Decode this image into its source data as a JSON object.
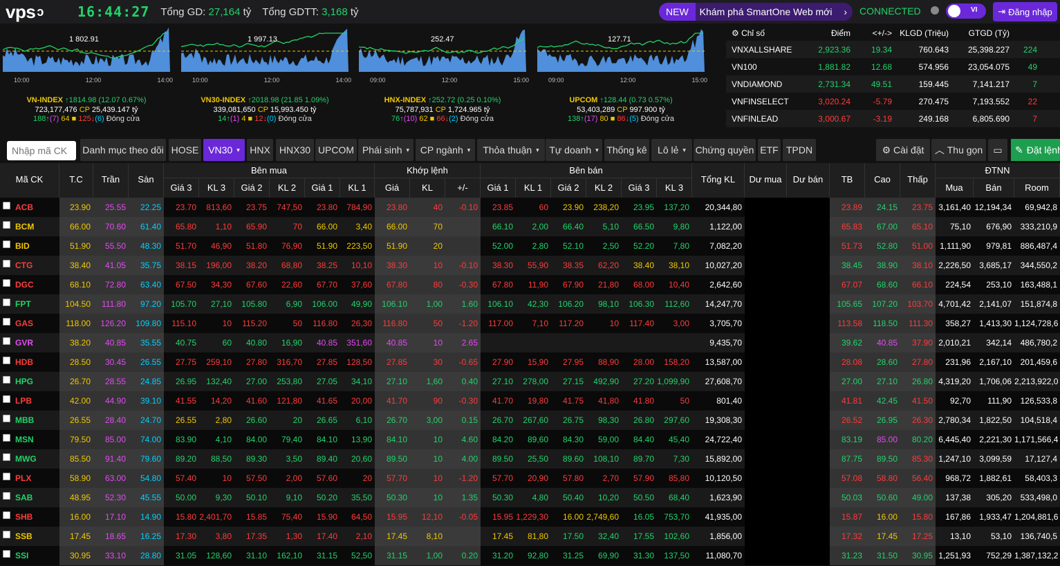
{
  "header": {
    "logo": "vps",
    "clock": "16:44:27",
    "tong_gd_label": "Tổng GD:",
    "tong_gd_value": "27,164",
    "tong_gd_unit": "tỷ",
    "tong_gdtt_label": "Tổng GDTT:",
    "tong_gdtt_value": "3,168",
    "tong_gdtt_unit": "tỷ",
    "new_badge": "NEW",
    "new_text": "Khám phá SmartOne Web mới",
    "new_arrow": "›",
    "connection": "CONNECTED",
    "lang": "VI",
    "login": "Đăng nhập",
    "accent": "#6a28d9"
  },
  "indices": [
    {
      "name": "VN-INDEX",
      "value": "1814.98",
      "change": "(12.07",
      "pct": "0.67%)",
      "chart_label": "1 802.91",
      "volume": "723,177,476",
      "value_vnd": "25,439.147",
      "up": "188",
      "ceil": "(7)",
      "ref": "64",
      "down": "125",
      "floor": "(6)",
      "status": "Đóng cửa",
      "times": [
        "10:00",
        "12:00",
        "14:00"
      ]
    },
    {
      "name": "VN30-INDEX",
      "value": "2018.98",
      "change": "(21.85",
      "pct": "1.09%)",
      "chart_label": "1 997.13",
      "volume": "339,081,650",
      "value_vnd": "15,993.450",
      "up": "14",
      "ceil": "(1)",
      "ref": "4",
      "down": "12",
      "floor": "(0)",
      "status": "Đóng cửa",
      "times": [
        "10:00",
        "12:00",
        "14:00"
      ]
    },
    {
      "name": "HNX-INDEX",
      "value": "252.72",
      "change": "(0.25",
      "pct": "0.10%)",
      "chart_label": "252.47",
      "volume": "75,787,931",
      "value_vnd": "1,724.965",
      "up": "76",
      "ceil": "(10)",
      "ref": "62",
      "down": "66",
      "floor": "(2)",
      "status": "Đóng cửa",
      "times": [
        "09:00",
        "12:00",
        "15:00"
      ]
    },
    {
      "name": "UPCOM",
      "value": "128.44",
      "change": "(0.73",
      "pct": "0.57%)",
      "chart_label": "127.71",
      "volume": "53,403,289",
      "value_vnd": "997.900",
      "up": "138",
      "ceil": "(17)",
      "ref": "80",
      "down": "86",
      "floor": "(5)",
      "status": "Đóng cửa",
      "times": [
        "09:00",
        "12:00",
        "15:00"
      ]
    }
  ],
  "index_table": {
    "headers": [
      "Chỉ số",
      "Điểm",
      "<+/->",
      "KLGD (Triệu)",
      "GTGD (Tỷ)"
    ],
    "rows": [
      {
        "name": "VNXALLSHARE",
        "point": "2,923.36",
        "chg": "19.34",
        "vol": "760.643",
        "val": "25,398.227",
        "extra": "224",
        "color": "g"
      },
      {
        "name": "VN100",
        "point": "1,881.82",
        "chg": "12.68",
        "vol": "574.956",
        "val": "23,054.075",
        "extra": "49",
        "color": "g"
      },
      {
        "name": "VNDIAMOND",
        "point": "2,731.34",
        "chg": "49.51",
        "vol": "159.445",
        "val": "7,141.217",
        "extra": "7",
        "color": "g"
      },
      {
        "name": "VNFINSELECT",
        "point": "3,020.24",
        "chg": "-5.79",
        "vol": "270.475",
        "val": "7,193.552",
        "extra": "22",
        "color": "r"
      },
      {
        "name": "VNFINLEAD",
        "point": "3,000.67",
        "chg": "-3.19",
        "vol": "249.168",
        "val": "6,805.690",
        "extra": "7",
        "color": "r"
      }
    ]
  },
  "tabs": {
    "search_placeholder": "Nhập mã CK",
    "items": [
      "Danh mục theo dõi",
      "HOSE",
      "VN30",
      "HNX",
      "HNX30",
      "UPCOM",
      "Phái sinh",
      "CP ngành",
      "Thỏa thuận",
      "Tự doanh",
      "Thống kê",
      "Lô lẻ",
      "Chứng quyền",
      "ETF",
      "TPDN"
    ],
    "settings": "Cài đặt",
    "collapse": "Thu gọn",
    "order": "Đặt lệnh"
  },
  "board_headers": {
    "symbol": "Mã CK",
    "ref": "T.C",
    "ceil": "Trần",
    "floor": "Sàn",
    "buy_group": "Bên mua",
    "match_group": "Khớp lệnh",
    "sell_group": "Bên bán",
    "total_vol": "Tổng KL",
    "buy_rem": "Dư mua",
    "sell_rem": "Dư bán",
    "avg": "TB",
    "high": "Cao",
    "low": "Thấp",
    "foreign": "ĐTNN",
    "buy_sub": [
      "Giá 3",
      "KL 3",
      "Giá 2",
      "KL 2",
      "Giá 1",
      "KL 1"
    ],
    "match_sub": [
      "Giá",
      "KL",
      "+/-"
    ],
    "sell_sub": [
      "Giá 1",
      "KL 1",
      "Giá 2",
      "KL 2",
      "Giá 3",
      "KL 3"
    ],
    "foreign_sub": [
      "Mua",
      "Bán",
      "Room"
    ]
  },
  "rows": [
    {
      "sym": "ACB",
      "sc": "r",
      "ref": "23.90",
      "ceil": "25.55",
      "floor": "22.25",
      "b3": "23.70",
      "b3c": "r",
      "kb3": "813,60",
      "b2": "23.75",
      "b2c": "r",
      "kb2": "747,50",
      "b1": "23.80",
      "b1c": "r",
      "kb1": "784,90",
      "mp": "23.80",
      "mc": "r",
      "mv": "40",
      "ch": "-0.10",
      "s1": "23.85",
      "s1c": "r",
      "ks1": "60",
      "s2": "23.90",
      "s2c": "y",
      "ks2": "238,20",
      "s3": "23.95",
      "s3c": "g",
      "ks3": "137,20",
      "tot": "20,344,80",
      "avg": "23.89",
      "avc": "r",
      "hi": "24.15",
      "hic": "g",
      "lo": "23.75",
      "loc": "r",
      "fb": "3,161,40",
      "fs": "12,194,34",
      "room": "69,942,8"
    },
    {
      "sym": "BCM",
      "sc": "y",
      "ref": "66.00",
      "ceil": "70.60",
      "floor": "61.40",
      "b3": "65.80",
      "b3c": "r",
      "kb3": "1,10",
      "b2": "65.90",
      "b2c": "r",
      "kb2": "70",
      "b1": "66.00",
      "b1c": "y",
      "kb1": "3,40",
      "mp": "66.00",
      "mc": "y",
      "mv": "70",
      "ch": "",
      "s1": "66.10",
      "s1c": "g",
      "ks1": "2,00",
      "s2": "66.40",
      "s2c": "g",
      "ks2": "5,10",
      "s3": "66.50",
      "s3c": "g",
      "ks3": "9,80",
      "tot": "1,122,00",
      "avg": "65.83",
      "avc": "r",
      "hi": "67.00",
      "hic": "g",
      "lo": "65.10",
      "loc": "r",
      "fb": "75,10",
      "fs": "676,90",
      "room": "333,210,9"
    },
    {
      "sym": "BID",
      "sc": "y",
      "ref": "51.90",
      "ceil": "55.50",
      "floor": "48.30",
      "b3": "51.70",
      "b3c": "r",
      "kb3": "46,90",
      "b2": "51.80",
      "b2c": "r",
      "kb2": "76,90",
      "b1": "51.90",
      "b1c": "y",
      "kb1": "223,50",
      "mp": "51.90",
      "mc": "y",
      "mv": "20",
      "ch": "",
      "s1": "52.00",
      "s1c": "g",
      "ks1": "2,80",
      "s2": "52.10",
      "s2c": "g",
      "ks2": "2,50",
      "s3": "52.20",
      "s3c": "g",
      "ks3": "7,80",
      "tot": "7,082,20",
      "avg": "51.73",
      "avc": "r",
      "hi": "52.80",
      "hic": "g",
      "lo": "51.00",
      "loc": "r",
      "fb": "1,111,90",
      "fs": "979,81",
      "room": "886,487,4"
    },
    {
      "sym": "CTG",
      "sc": "r",
      "ref": "38.40",
      "ceil": "41.05",
      "floor": "35.75",
      "b3": "38.15",
      "b3c": "r",
      "kb3": "196,00",
      "b2": "38.20",
      "b2c": "r",
      "kb2": "68,80",
      "b1": "38.25",
      "b1c": "r",
      "kb1": "10,10",
      "mp": "38.30",
      "mc": "r",
      "mv": "10",
      "ch": "-0.10",
      "s1": "38.30",
      "s1c": "r",
      "ks1": "55,90",
      "s2": "38.35",
      "s2c": "r",
      "ks2": "62,20",
      "s3": "38.40",
      "s3c": "y",
      "ks3": "38,10",
      "tot": "10,027,20",
      "avg": "38.45",
      "avc": "g",
      "hi": "38.90",
      "hic": "g",
      "lo": "38.10",
      "loc": "r",
      "fb": "2,226,50",
      "fs": "3,685,17",
      "room": "344,550,2"
    },
    {
      "sym": "DGC",
      "sc": "r",
      "ref": "68.10",
      "ceil": "72.80",
      "floor": "63.40",
      "b3": "67.50",
      "b3c": "r",
      "kb3": "34,30",
      "b2": "67.60",
      "b2c": "r",
      "kb2": "22,60",
      "b1": "67.70",
      "b1c": "r",
      "kb1": "37,60",
      "mp": "67.80",
      "mc": "r",
      "mv": "80",
      "ch": "-0.30",
      "s1": "67.80",
      "s1c": "r",
      "ks1": "11,90",
      "s2": "67.90",
      "s2c": "r",
      "ks2": "21,80",
      "s3": "68.00",
      "s3c": "r",
      "ks3": "10,40",
      "tot": "2,642,60",
      "avg": "67.07",
      "avc": "r",
      "hi": "68.60",
      "hic": "g",
      "lo": "66.10",
      "loc": "r",
      "fb": "224,54",
      "fs": "253,10",
      "room": "163,488,1"
    },
    {
      "sym": "FPT",
      "sc": "g",
      "ref": "104.50",
      "ceil": "111.80",
      "floor": "97.20",
      "b3": "105.70",
      "b3c": "g",
      "kb3": "27,10",
      "b2": "105.80",
      "b2c": "g",
      "kb2": "6,90",
      "b1": "106.00",
      "b1c": "g",
      "kb1": "49,90",
      "mp": "106.10",
      "mc": "g",
      "mv": "1,00",
      "ch": "1.60",
      "s1": "106.10",
      "s1c": "g",
      "ks1": "42,30",
      "s2": "106.20",
      "s2c": "g",
      "ks2": "98,10",
      "s3": "106.30",
      "s3c": "g",
      "ks3": "112,60",
      "tot": "14,247,70",
      "avg": "105.65",
      "avc": "g",
      "hi": "107.20",
      "hic": "g",
      "lo": "103.70",
      "loc": "r",
      "fb": "4,701,42",
      "fs": "2,141,07",
      "room": "151,874,8"
    },
    {
      "sym": "GAS",
      "sc": "r",
      "ref": "118.00",
      "ceil": "126.20",
      "floor": "109.80",
      "b3": "115.10",
      "b3c": "r",
      "kb3": "10",
      "b2": "115.20",
      "b2c": "r",
      "kb2": "50",
      "b1": "116.80",
      "b1c": "r",
      "kb1": "26,30",
      "mp": "116.80",
      "mc": "r",
      "mv": "50",
      "ch": "-1.20",
      "s1": "117.00",
      "s1c": "r",
      "ks1": "7,10",
      "s2": "117.20",
      "s2c": "r",
      "ks2": "10",
      "s3": "117.40",
      "s3c": "r",
      "ks3": "3,00",
      "tot": "3,705,70",
      "avg": "113.58",
      "avc": "r",
      "hi": "118.50",
      "hic": "g",
      "lo": "111.30",
      "loc": "r",
      "fb": "358,27",
      "fs": "1,413,30",
      "room": "1,124,728,6"
    },
    {
      "sym": "GVR",
      "sc": "p",
      "ref": "38.20",
      "ceil": "40.85",
      "floor": "35.55",
      "b3": "40.75",
      "b3c": "g",
      "kb3": "60",
      "b2": "40.80",
      "b2c": "g",
      "kb2": "16,90",
      "b1": "40.85",
      "b1c": "p",
      "kb1": "351,60",
      "mp": "40.85",
      "mc": "p",
      "mv": "10",
      "ch": "2.65",
      "s1": "",
      "s1c": "g",
      "ks1": "",
      "s2": "",
      "s2c": "g",
      "ks2": "",
      "s3": "",
      "s3c": "g",
      "ks3": "",
      "tot": "9,435,70",
      "avg": "39.62",
      "avc": "g",
      "hi": "40.85",
      "hic": "p",
      "lo": "37.90",
      "loc": "r",
      "fb": "2,010,21",
      "fs": "342,14",
      "room": "486,780,2"
    },
    {
      "sym": "HDB",
      "sc": "r",
      "ref": "28.50",
      "ceil": "30.45",
      "floor": "26.55",
      "b3": "27.75",
      "b3c": "r",
      "kb3": "259,10",
      "b2": "27.80",
      "b2c": "r",
      "kb2": "316,70",
      "b1": "27.85",
      "b1c": "r",
      "kb1": "128,50",
      "mp": "27.85",
      "mc": "r",
      "mv": "30",
      "ch": "-0.65",
      "s1": "27.90",
      "s1c": "r",
      "ks1": "15,90",
      "s2": "27.95",
      "s2c": "r",
      "ks2": "88,90",
      "s3": "28.00",
      "s3c": "r",
      "ks3": "158,20",
      "tot": "13,587,00",
      "avg": "28.08",
      "avc": "r",
      "hi": "28.60",
      "hic": "g",
      "lo": "27.80",
      "loc": "r",
      "fb": "231,96",
      "fs": "2,167,10",
      "room": "201,459,6"
    },
    {
      "sym": "HPG",
      "sc": "g",
      "ref": "26.70",
      "ceil": "28.55",
      "floor": "24.85",
      "b3": "26.95",
      "b3c": "g",
      "kb3": "132,40",
      "b2": "27.00",
      "b2c": "g",
      "kb2": "253,80",
      "b1": "27.05",
      "b1c": "g",
      "kb1": "34,10",
      "mp": "27.10",
      "mc": "g",
      "mv": "1,60",
      "ch": "0.40",
      "s1": "27.10",
      "s1c": "g",
      "ks1": "278,00",
      "s2": "27.15",
      "s2c": "g",
      "ks2": "492,90",
      "s3": "27.20",
      "s3c": "g",
      "ks3": "1,099,90",
      "tot": "27,608,70",
      "avg": "27.00",
      "avc": "g",
      "hi": "27.10",
      "hic": "g",
      "lo": "26.80",
      "loc": "g",
      "fb": "4,319,20",
      "fs": "1,706,06",
      "room": "2,213,922,0"
    },
    {
      "sym": "LPB",
      "sc": "r",
      "ref": "42.00",
      "ceil": "44.90",
      "floor": "39.10",
      "b3": "41.55",
      "b3c": "r",
      "kb3": "14,20",
      "b2": "41.60",
      "b2c": "r",
      "kb2": "121,80",
      "b1": "41.65",
      "b1c": "r",
      "kb1": "20,00",
      "mp": "41.70",
      "mc": "r",
      "mv": "90",
      "ch": "-0.30",
      "s1": "41.70",
      "s1c": "r",
      "ks1": "19,80",
      "s2": "41.75",
      "s2c": "r",
      "ks2": "41,80",
      "s3": "41.80",
      "s3c": "r",
      "ks3": "50",
      "tot": "801,40",
      "avg": "41.81",
      "avc": "r",
      "hi": "42.45",
      "hic": "g",
      "lo": "41.50",
      "loc": "r",
      "fb": "92,70",
      "fs": "111,90",
      "room": "126,533,8"
    },
    {
      "sym": "MBB",
      "sc": "g",
      "ref": "26.55",
      "ceil": "28.40",
      "floor": "24.70",
      "b3": "26.55",
      "b3c": "y",
      "kb3": "2,80",
      "b2": "26.60",
      "b2c": "g",
      "kb2": "20",
      "b1": "26.65",
      "b1c": "g",
      "kb1": "6,10",
      "mp": "26.70",
      "mc": "g",
      "mv": "3,00",
      "ch": "0.15",
      "s1": "26.70",
      "s1c": "g",
      "ks1": "267,60",
      "s2": "26.75",
      "s2c": "g",
      "ks2": "98,30",
      "s3": "26.80",
      "s3c": "g",
      "ks3": "297,60",
      "tot": "19,308,30",
      "avg": "26.52",
      "avc": "r",
      "hi": "26.95",
      "hic": "g",
      "lo": "26.30",
      "loc": "r",
      "fb": "2,780,34",
      "fs": "1,822,50",
      "room": "104,518,4"
    },
    {
      "sym": "MSN",
      "sc": "g",
      "ref": "79.50",
      "ceil": "85.00",
      "floor": "74.00",
      "b3": "83.90",
      "b3c": "g",
      "kb3": "4,10",
      "b2": "84.00",
      "b2c": "g",
      "kb2": "79,40",
      "b1": "84.10",
      "b1c": "g",
      "kb1": "13,90",
      "mp": "84.10",
      "mc": "g",
      "mv": "10",
      "ch": "4.60",
      "s1": "84.20",
      "s1c": "g",
      "ks1": "89,60",
      "s2": "84.30",
      "s2c": "g",
      "ks2": "59,00",
      "s3": "84.40",
      "s3c": "g",
      "ks3": "45,40",
      "tot": "24,722,40",
      "avg": "83.19",
      "avc": "g",
      "hi": "85.00",
      "hic": "p",
      "lo": "80.20",
      "loc": "g",
      "fb": "6,445,40",
      "fs": "2,221,30",
      "room": "1,171,566,4"
    },
    {
      "sym": "MWG",
      "sc": "g",
      "ref": "85.50",
      "ceil": "91.40",
      "floor": "79.60",
      "b3": "89.20",
      "b3c": "g",
      "kb3": "88,50",
      "b2": "89.30",
      "b2c": "g",
      "kb2": "3,50",
      "b1": "89.40",
      "b1c": "g",
      "kb1": "20,60",
      "mp": "89.50",
      "mc": "g",
      "mv": "10",
      "ch": "4.00",
      "s1": "89.50",
      "s1c": "g",
      "ks1": "25,50",
      "s2": "89.60",
      "s2c": "g",
      "ks2": "108,10",
      "s3": "89.70",
      "s3c": "g",
      "ks3": "7,30",
      "tot": "15,892,00",
      "avg": "87.75",
      "avc": "g",
      "hi": "89.50",
      "hic": "g",
      "lo": "85.30",
      "loc": "r",
      "fb": "1,247,10",
      "fs": "3,099,59",
      "room": "17,127,4"
    },
    {
      "sym": "PLX",
      "sc": "r",
      "ref": "58.90",
      "ceil": "63.00",
      "floor": "54.80",
      "b3": "57.40",
      "b3c": "r",
      "kb3": "10",
      "b2": "57.50",
      "b2c": "r",
      "kb2": "2,00",
      "b1": "57.60",
      "b1c": "r",
      "kb1": "20",
      "mp": "57.70",
      "mc": "r",
      "mv": "10",
      "ch": "-1.20",
      "s1": "57.70",
      "s1c": "r",
      "ks1": "20,90",
      "s2": "57.80",
      "s2c": "r",
      "ks2": "2,70",
      "s3": "57.90",
      "s3c": "r",
      "ks3": "85,80",
      "tot": "10,120,50",
      "avg": "57.08",
      "avc": "r",
      "hi": "58.80",
      "hic": "r",
      "lo": "56.40",
      "loc": "r",
      "fb": "968,72",
      "fs": "1,882,61",
      "room": "58,403,3"
    },
    {
      "sym": "SAB",
      "sc": "g",
      "ref": "48.95",
      "ceil": "52.30",
      "floor": "45.55",
      "b3": "50.00",
      "b3c": "g",
      "kb3": "9,30",
      "b2": "50.10",
      "b2c": "g",
      "kb2": "9,10",
      "b1": "50.20",
      "b1c": "g",
      "kb1": "35,50",
      "mp": "50.30",
      "mc": "g",
      "mv": "10",
      "ch": "1.35",
      "s1": "50.30",
      "s1c": "g",
      "ks1": "4,80",
      "s2": "50.40",
      "s2c": "g",
      "ks2": "10,20",
      "s3": "50.50",
      "s3c": "g",
      "ks3": "68,40",
      "tot": "1,623,90",
      "avg": "50.03",
      "avc": "g",
      "hi": "50.60",
      "hic": "g",
      "lo": "49.00",
      "loc": "g",
      "fb": "137,38",
      "fs": "305,20",
      "room": "533,498,0"
    },
    {
      "sym": "SHB",
      "sc": "r",
      "ref": "16.00",
      "ceil": "17.10",
      "floor": "14.90",
      "b3": "15.80",
      "b3c": "r",
      "kb3": "2,401,70",
      "b2": "15.85",
      "b2c": "r",
      "kb2": "75,40",
      "b1": "15.90",
      "b1c": "r",
      "kb1": "64,50",
      "mp": "15.95",
      "mc": "r",
      "mv": "12,10",
      "ch": "-0.05",
      "s1": "15.95",
      "s1c": "r",
      "ks1": "1,229,30",
      "s2": "16.00",
      "s2c": "y",
      "ks2": "2,749,60",
      "s3": "16.05",
      "s3c": "g",
      "ks3": "753,70",
      "tot": "41,935,00",
      "avg": "15.87",
      "avc": "r",
      "hi": "16.00",
      "hic": "y",
      "lo": "15.80",
      "loc": "r",
      "fb": "167,86",
      "fs": "1,933,47",
      "room": "1,204,881,6"
    },
    {
      "sym": "SSB",
      "sc": "y",
      "ref": "17.45",
      "ceil": "18.65",
      "floor": "16.25",
      "b3": "17.30",
      "b3c": "r",
      "kb3": "3,80",
      "b2": "17.35",
      "b2c": "r",
      "kb2": "1,30",
      "b1": "17.40",
      "b1c": "r",
      "kb1": "2,10",
      "mp": "17.45",
      "mc": "y",
      "mv": "8,10",
      "ch": "",
      "s1": "17.45",
      "s1c": "y",
      "ks1": "81,80",
      "s2": "17.50",
      "s2c": "g",
      "ks2": "32,40",
      "s3": "17.55",
      "s3c": "g",
      "ks3": "102,60",
      "tot": "1,856,00",
      "avg": "17.32",
      "avc": "r",
      "hi": "17.45",
      "hic": "y",
      "lo": "17.25",
      "loc": "r",
      "fb": "13,10",
      "fs": "53,10",
      "room": "136,740,5"
    },
    {
      "sym": "SSI",
      "sc": "g",
      "ref": "30.95",
      "ceil": "33.10",
      "floor": "28.80",
      "b3": "31.05",
      "b3c": "g",
      "kb3": "128,60",
      "b2": "31.10",
      "b2c": "g",
      "kb2": "162,10",
      "b1": "31.15",
      "b1c": "g",
      "kb1": "52,50",
      "mp": "31.15",
      "mc": "g",
      "mv": "1,00",
      "ch": "0.20",
      "s1": "31.20",
      "s1c": "g",
      "ks1": "92,80",
      "s2": "31.25",
      "s2c": "g",
      "ks2": "69,90",
      "s3": "31.30",
      "s3c": "g",
      "ks3": "137,50",
      "tot": "11,080,70",
      "avg": "31.23",
      "avc": "g",
      "hi": "31.50",
      "hic": "g",
      "lo": "30.95",
      "loc": "g",
      "fb": "1,251,93",
      "fs": "752,29",
      "room": "1,387,132,2"
    }
  ]
}
